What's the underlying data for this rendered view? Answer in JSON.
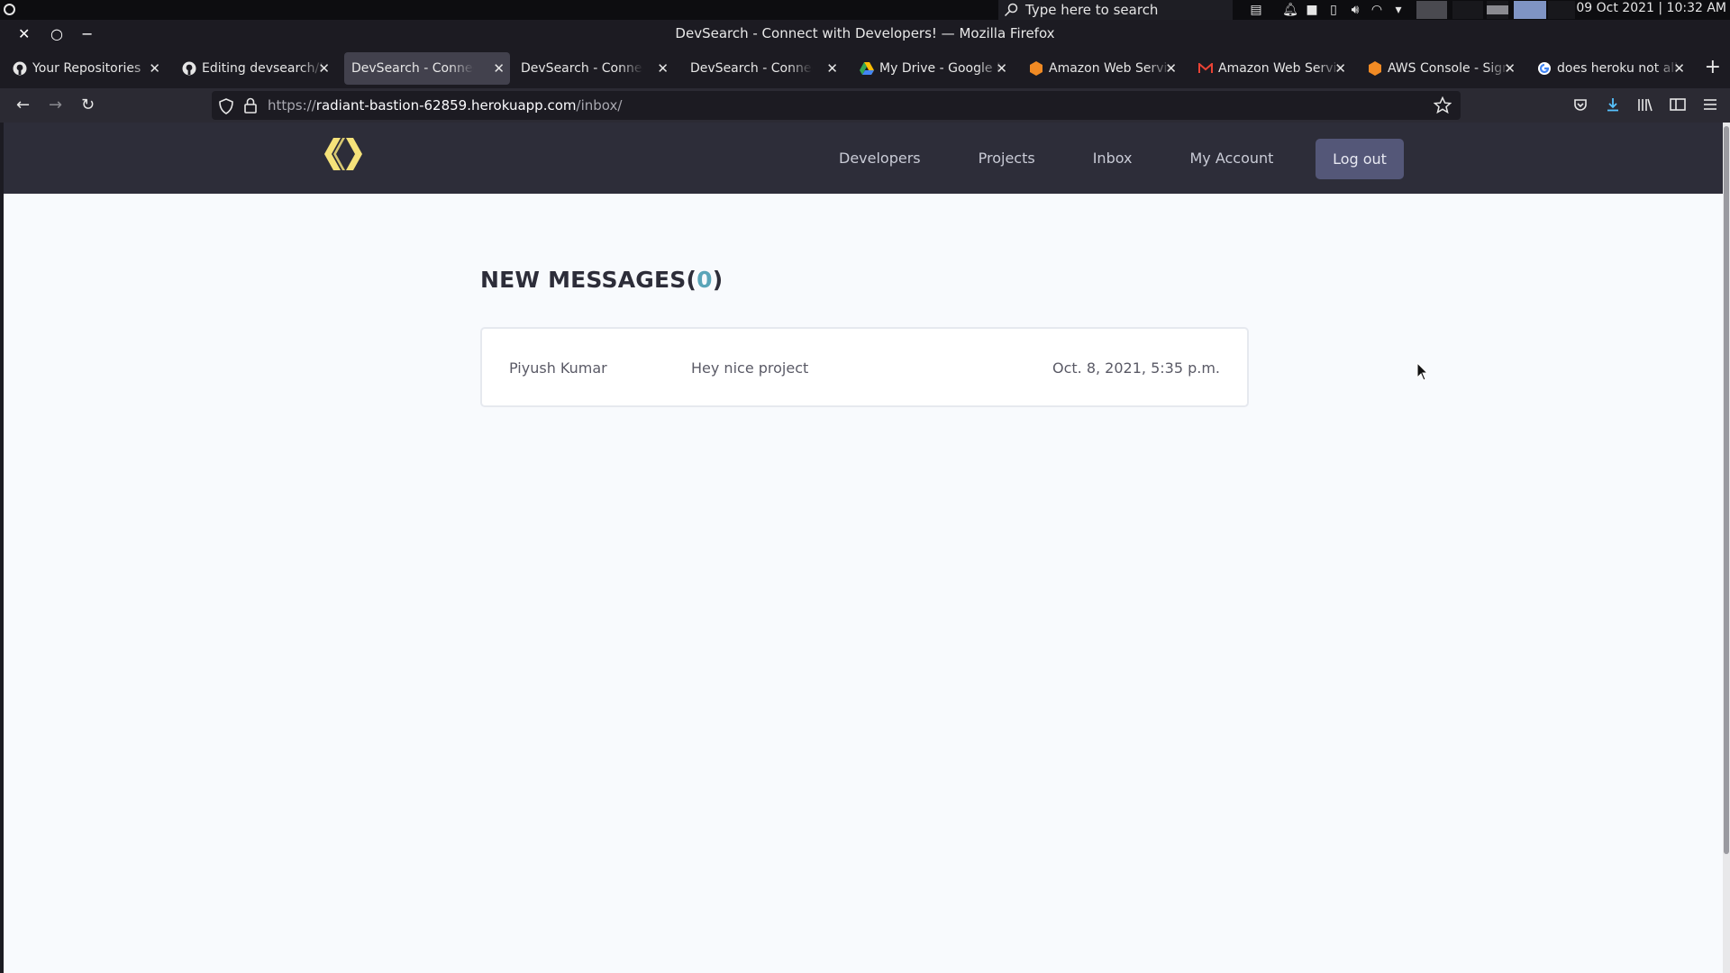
{
  "os": {
    "search_placeholder": "Type here to search",
    "clock": "09 Oct 2021 | 10:32 AM"
  },
  "window": {
    "title": "DevSearch - Connect with Developers! — Mozilla Firefox"
  },
  "tabs": [
    {
      "label": "Your Repositories",
      "icon": "github-icon",
      "active": false
    },
    {
      "label": "Editing devsearch/README",
      "icon": "github-icon",
      "active": false
    },
    {
      "label": "DevSearch - Connect with Developers!",
      "icon": "",
      "active": true
    },
    {
      "label": "DevSearch - Connect with Developers!",
      "icon": "",
      "active": false
    },
    {
      "label": "DevSearch - Connect with Developers!",
      "icon": "",
      "active": false
    },
    {
      "label": "My Drive - Google Drive",
      "icon": "google-drive-icon",
      "active": false
    },
    {
      "label": "Amazon Web Services",
      "icon": "aws-icon",
      "active": false
    },
    {
      "label": "Amazon Web Services",
      "icon": "gmail-icon",
      "active": false
    },
    {
      "label": "AWS Console - Signup",
      "icon": "aws-icon",
      "active": false
    },
    {
      "label": "does heroku not allow",
      "icon": "google-icon",
      "active": false
    }
  ],
  "address_bar": {
    "url_prefix": "https://",
    "url_host": "radiant-bastion-62859.herokuapp.com",
    "url_path": "/inbox/"
  },
  "site": {
    "nav": {
      "developers": "Developers",
      "projects": "Projects",
      "inbox": "Inbox",
      "account": "My Account",
      "logout": "Log out"
    },
    "logo_color": "#f5e27a"
  },
  "inbox": {
    "heading_text": "NEW MESSAGES",
    "open_paren": "(",
    "unread_count": "0",
    "close_paren": ")",
    "messages": [
      {
        "sender": "Piyush Kumar",
        "subject": "Hey nice project",
        "date": "Oct. 8, 2021, 5:35 p.m."
      }
    ]
  },
  "colors": {
    "accent": "#5aa5b9",
    "header_bg": "#2d2d39",
    "button_bg": "#545778"
  }
}
